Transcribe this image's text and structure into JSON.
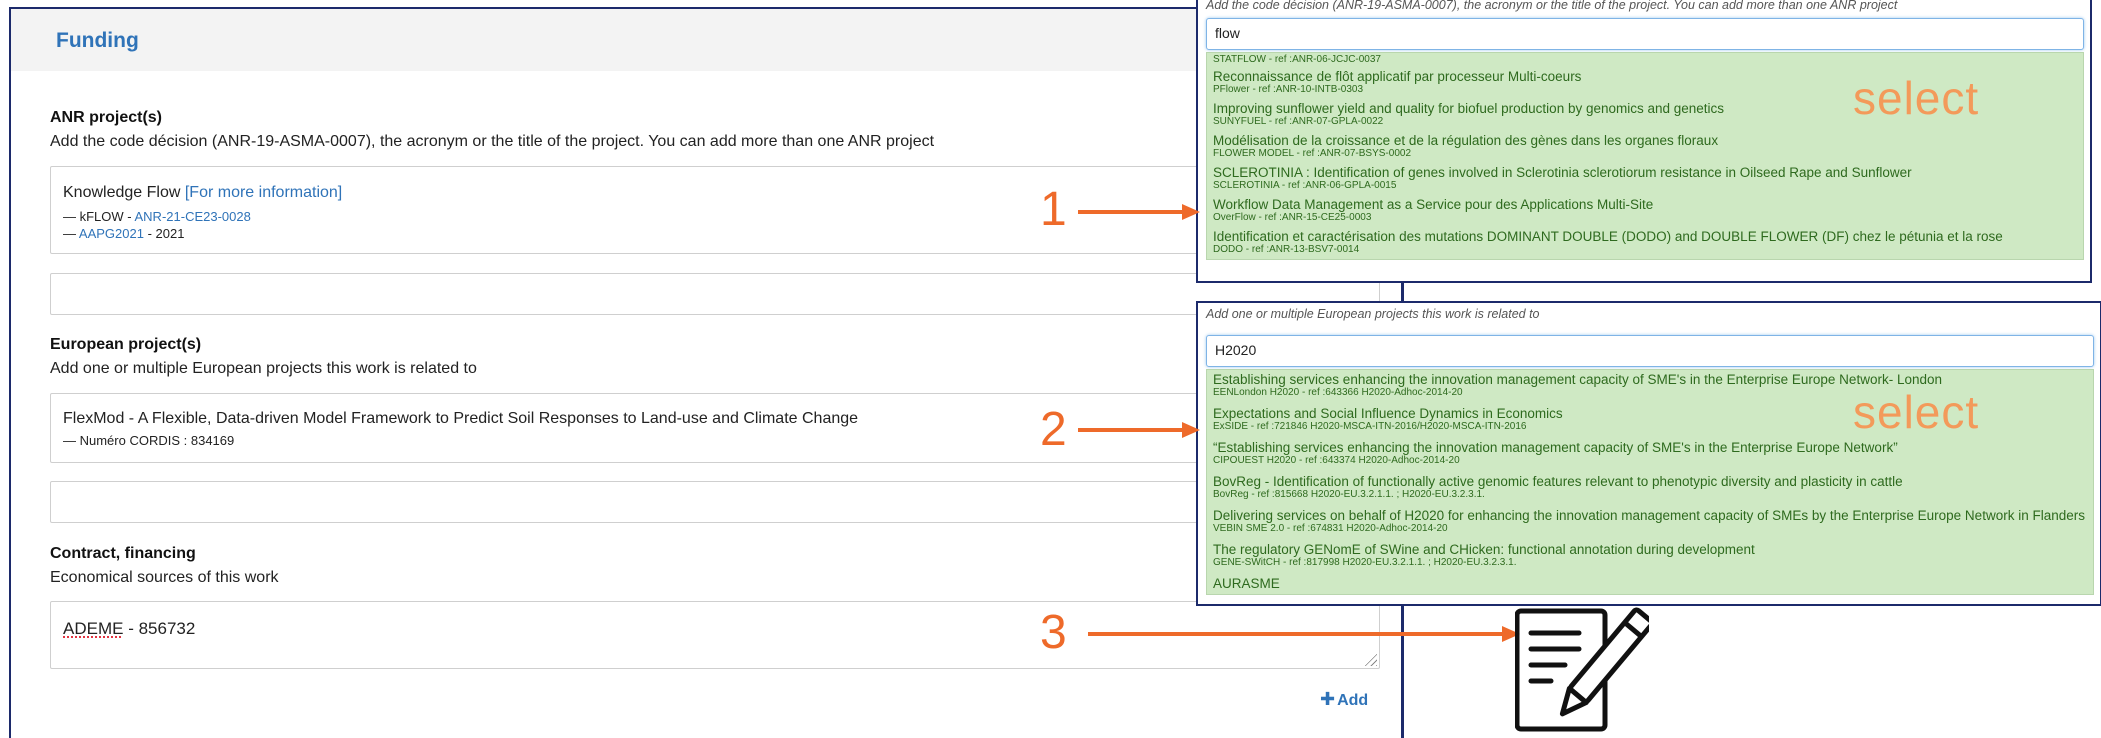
{
  "form": {
    "header_title": "Funding",
    "anr": {
      "title": "ANR project(s)",
      "description": "Add the code décision (ANR-19-ASMA-0007), the acronym or the title of the project. You can add more than one ANR project",
      "entry_name": "Knowledge Flow",
      "entry_info_link": "[For more information]",
      "entry_line1_prefix": "— kFLOW - ",
      "entry_line1_link": "ANR-21-CE23-0028",
      "entry_line2_prefix": "— ",
      "entry_line2_link": "AAPG2021",
      "entry_line2_suffix": " - 2021"
    },
    "european": {
      "title": "European project(s)",
      "description": "Add one or multiple European projects this work is related to",
      "entry_name": "FlexMod - A Flexible, Data-driven Model Framework to Predict Soil Responses to Land-use and Climate Change",
      "entry_sub": "— Numéro CORDIS : 834169"
    },
    "contract": {
      "title": "Contract, financing",
      "description": "Economical sources of this work",
      "value_org": "ADEME",
      "value_rest": " - 856732"
    },
    "add_label": "Add"
  },
  "popup_anr": {
    "hint": "Add the code décision (ANR-19-ASMA-0007), the acronym or the title of the project. You can add more than one ANR project",
    "search_value": "flow",
    "select_label": "select",
    "results": [
      {
        "title": "",
        "sub": "STATFLOW - ref :ANR-06-JCJC-0037"
      },
      {
        "title": "Reconnaissance de flôt applicatif par processeur Multi-coeurs",
        "sub": "PFlower - ref :ANR-10-INTB-0303"
      },
      {
        "title": "Improving sunflower yield and quality for biofuel production by genomics and genetics",
        "sub": "SUNYFUEL - ref :ANR-07-GPLA-0022"
      },
      {
        "title": "Modélisation de la croissance et de la régulation des gènes dans les organes floraux",
        "sub": "FLOWER MODEL - ref :ANR-07-BSYS-0002"
      },
      {
        "title": "SCLEROTINIA : Identification of genes involved in Sclerotinia sclerotiorum resistance in Oilseed Rape and Sunflower",
        "sub": "SCLEROTINIA - ref :ANR-06-GPLA-0015"
      },
      {
        "title": "Workflow Data Management as a Service pour des Applications Multi-Site",
        "sub": "OverFlow - ref :ANR-15-CE25-0003"
      },
      {
        "title": "Identification et caractérisation des mutations DOMINANT DOUBLE (DODO) and DOUBLE FLOWER (DF) chez le pétunia et la rose",
        "sub": "DODO - ref :ANR-13-BSV7-0014"
      }
    ]
  },
  "popup_eu": {
    "hint": "Add one or multiple European projects this work is related to",
    "search_value": "H2020",
    "select_label": "select",
    "results": [
      {
        "title": "Establishing services enhancing the innovation management capacity of SME's in the Enterprise Europe Network- London",
        "sub": "EENLondon H2020 - ref :643366 H2020-Adhoc-2014-20"
      },
      {
        "title": "Expectations and Social Influence Dynamics in Economics",
        "sub": "ExSIDE - ref :721846 H2020-MSCA-ITN-2016/H2020-MSCA-ITN-2016"
      },
      {
        "title": "“Establishing services enhancing the innovation management capacity of SME's in the Enterprise Europe Network”",
        "sub": "CIPOUEST H2020 - ref :643374 H2020-Adhoc-2014-20"
      },
      {
        "title": "BovReg - Identification of functionally active genomic features relevant to phenotypic diversity and plasticity in cattle",
        "sub": "BovReg - ref :815668 H2020-EU.3.2.1.1. ; H2020-EU.3.2.3.1."
      },
      {
        "title": "Delivering services on behalf of H2020 for enhancing the innovation management capacity of SMEs by the Enterprise Europe Network in Flanders",
        "sub": "VEBIN SME 2.0 - ref :674831 H2020-Adhoc-2014-20"
      },
      {
        "title": "The regulatory GENomE of SWine and CHicken: functional annotation during development",
        "sub": "GENE-SWitCH - ref :817998 H2020-EU.3.2.1.1. ; H2020-EU.3.2.3.1."
      },
      {
        "title": "AURASME",
        "sub": ""
      }
    ]
  },
  "annotations": {
    "n1": "1",
    "n2": "2",
    "n3": "3",
    "color": "#ee6a2a"
  },
  "icons": {
    "notepad": "notepad-pencil-icon"
  }
}
